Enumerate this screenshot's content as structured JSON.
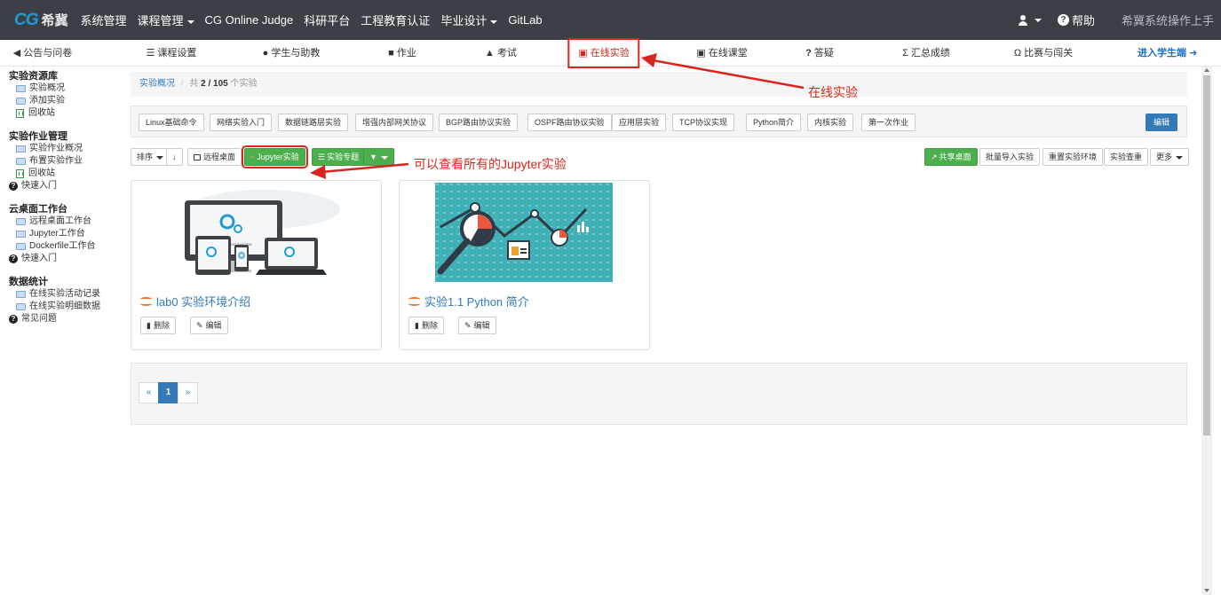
{
  "brand": {
    "logo_mark": "CG",
    "logo_text": "希冀"
  },
  "topnav": {
    "items": [
      "系统管理",
      "课程管理",
      "CG Online Judge",
      "科研平台",
      "工程教育认证",
      "毕业设计",
      "GitLab"
    ],
    "help": "帮助",
    "handbook": "希冀系统操作上手"
  },
  "subnav": {
    "items": [
      "公告与问卷",
      "课程设置",
      "学生与助教",
      "作业",
      "考试",
      "在线实验",
      "在线课堂",
      "答疑",
      "汇总成绩",
      "比赛与闯关"
    ],
    "student": "进入学生端"
  },
  "sidebar": {
    "groups": [
      {
        "title": "实验资源库",
        "items": [
          "实验概况",
          "添加实验",
          "回收站"
        ]
      },
      {
        "title": "实验作业管理",
        "items": [
          "实验作业概况",
          "布置实验作业",
          "回收站",
          "快速入门"
        ]
      },
      {
        "title": "云桌面工作台",
        "items": [
          "远程桌面工作台",
          "Jupyter工作台",
          "Dockerfile工作台",
          "快速入门"
        ]
      },
      {
        "title": "数据统计",
        "items": [
          "在线实验活动记录",
          "在线实验明细数据",
          "常见问题"
        ]
      }
    ]
  },
  "breadcrumb": {
    "link": "实验概况",
    "sep": "/",
    "prefix": "共",
    "count": "2 / 105",
    "suffix": "个实验"
  },
  "tags": [
    "Linux基础命令",
    "网络实验入门",
    "数据链路层实验",
    "增强内部网关协议",
    "BGP路由协议实验",
    "OSPF路由协议实验",
    "应用层实验",
    "TCP协议实现",
    "Python简介",
    "内核实验",
    "第一次作业"
  ],
  "tags_edit": "编辑",
  "toolbar": {
    "sort": "排序",
    "sort_icon": "↓",
    "remote_desktop": "远程桌面",
    "jupyter": "Jupyter实验",
    "topic": "实验专题",
    "filter": "▼",
    "share_desktop": "共享桌面",
    "batch_import": "批量导入实验",
    "reset_env": "重置实验环境",
    "check_dup": "实验查重",
    "more": "更多"
  },
  "cards": [
    {
      "title": "lab0 实验环境介绍",
      "delete": "删除",
      "edit": "编辑",
      "image": "devices-illustration"
    },
    {
      "title": "实验1.1 Python 简介",
      "delete": "删除",
      "edit": "编辑",
      "image": "analytics-illustration"
    }
  ],
  "pagination": {
    "prev": "«",
    "current": "1",
    "next": "»"
  },
  "illustration_text": {
    "os_label": "OPERATING SYSTEM"
  },
  "annotations": {
    "online_lab": "在线实验",
    "jupyter_note": "可以查看所有的Jupyter实验"
  },
  "colors": {
    "topbar": "#3d3f47",
    "accent_blue": "#337ab7",
    "green": "#4cae4c",
    "annotation_red": "#d9251d"
  }
}
